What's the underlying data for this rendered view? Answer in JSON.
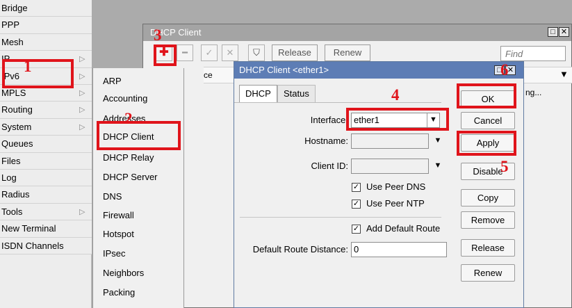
{
  "sidebar": {
    "items": [
      {
        "label": "Bridge",
        "arrow": false
      },
      {
        "label": "PPP",
        "arrow": false
      },
      {
        "label": "Mesh",
        "arrow": false
      },
      {
        "label": "IP",
        "arrow": true
      },
      {
        "label": "IPv6",
        "arrow": true
      },
      {
        "label": "MPLS",
        "arrow": true
      },
      {
        "label": "Routing",
        "arrow": true
      },
      {
        "label": "System",
        "arrow": true
      },
      {
        "label": "Queues",
        "arrow": false
      },
      {
        "label": "Files",
        "arrow": false
      },
      {
        "label": "Log",
        "arrow": false
      },
      {
        "label": "Radius",
        "arrow": false
      },
      {
        "label": "Tools",
        "arrow": true
      },
      {
        "label": "New Terminal",
        "arrow": false
      },
      {
        "label": "ISDN Channels",
        "arrow": false
      }
    ],
    "arrow_glyph": "▷"
  },
  "submenu": {
    "items": [
      "ARP",
      "Accounting",
      "Addresses",
      "DHCP Client",
      "DHCP Relay",
      "DHCP Server",
      "DNS",
      "Firewall",
      "Hotspot",
      "IPsec",
      "Neighbors",
      "Packing"
    ]
  },
  "dhcp_window": {
    "title": "DHCP Client",
    "toolbar": {
      "add": "✚",
      "remove": "━",
      "enable": "✓",
      "disable": "✕",
      "filter": "⛉",
      "release": "Release",
      "renew": "Renew",
      "find_placeholder": "Find"
    },
    "list": {
      "col_fragment": "ce",
      "status_fragment": "ng..."
    },
    "win_restore": "□",
    "win_close": "✕",
    "menu_arrow": "▼"
  },
  "dialog": {
    "title": "DHCP Client <ether1>",
    "tabs": [
      "DHCP",
      "Status"
    ],
    "fields": {
      "interface_label": "Interface:",
      "interface_value": "ether1",
      "hostname_label": "Hostname:",
      "hostname_value": "",
      "client_id_label": "Client ID:",
      "client_id_value": "",
      "use_peer_dns": "Use Peer DNS",
      "use_peer_ntp": "Use Peer NTP",
      "add_default_route": "Add Default Route",
      "route_distance_label": "Default Route Distance:",
      "route_distance_value": "0"
    },
    "checks": {
      "use_peer_dns": true,
      "use_peer_ntp": true,
      "add_default_route": true
    },
    "buttons": [
      "OK",
      "Cancel",
      "Apply",
      "Disable",
      "Copy",
      "Remove",
      "Release",
      "Renew"
    ]
  },
  "annotations": {
    "labels": [
      "1",
      "2",
      "3",
      "4",
      "5",
      "6"
    ],
    "color": "#e0141b"
  }
}
